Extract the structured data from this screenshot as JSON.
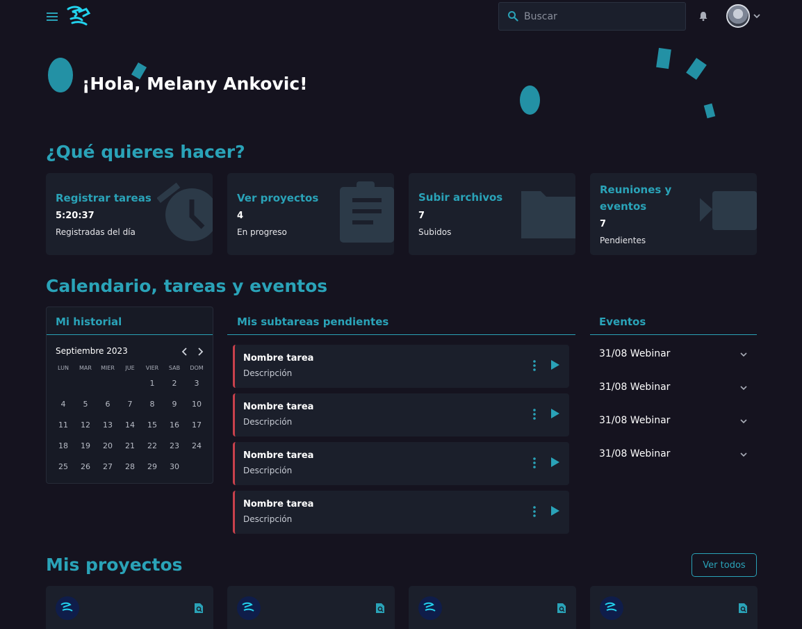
{
  "header": {
    "search_placeholder": "Buscar",
    "icons": [
      "menu-icon",
      "logo",
      "search-icon",
      "bell-icon",
      "avatar",
      "chevron-down-icon"
    ]
  },
  "greeting": "¡Hola, Melany Ankovic!",
  "quick_actions": {
    "title": "¿Qué quieres hacer?",
    "cards": [
      {
        "title": "Registrar tareas",
        "value": "5:20:37",
        "sub": "Registradas del día",
        "icon": "alarm-clock-icon"
      },
      {
        "title": "Ver proyectos",
        "value": "4",
        "sub": "En progreso",
        "icon": "clipboard-icon"
      },
      {
        "title": "Subir archivos",
        "value": "7",
        "sub": "Subidos",
        "icon": "folder-icon"
      },
      {
        "title": "Reuniones y eventos",
        "value": "7",
        "sub": "Pendientes",
        "icon": "video-camera-icon"
      }
    ]
  },
  "calendar_section": {
    "title": "Calendario, tareas y eventos",
    "history": {
      "title": "Mi historial",
      "month": "Septiembre 2023",
      "weekdays": [
        "LUN",
        "MAR",
        "MIER",
        "JUE",
        "VIER",
        "SAB",
        "DOM"
      ],
      "weeks": [
        [
          "",
          "",
          "",
          "",
          "1",
          "2",
          "3"
        ],
        [
          "4",
          "5",
          "6",
          "7",
          "8",
          "9",
          "10"
        ],
        [
          "11",
          "12",
          "13",
          "14",
          "15",
          "16",
          "17"
        ],
        [
          "18",
          "19",
          "20",
          "21",
          "22",
          "23",
          "24"
        ],
        [
          "25",
          "26",
          "27",
          "28",
          "29",
          "30",
          ""
        ]
      ]
    },
    "subtasks": {
      "title": "Mis subtareas pendientes",
      "items": [
        {
          "name": "Nombre tarea",
          "description": "Descripción"
        },
        {
          "name": "Nombre tarea",
          "description": "Descripción"
        },
        {
          "name": "Nombre tarea",
          "description": "Descripción"
        },
        {
          "name": "Nombre tarea",
          "description": "Descripción"
        }
      ]
    },
    "events": {
      "title": "Eventos",
      "items": [
        "31/08 Webinar",
        "31/08 Webinar",
        "31/08 Webinar",
        "31/08 Webinar"
      ]
    }
  },
  "projects": {
    "title": "Mis proyectos",
    "view_all": "Ver todos"
  },
  "colors": {
    "accent": "#2aa3b8",
    "background": "#15131f",
    "card": "#1b1f2b",
    "task_border": "#c8414c"
  }
}
